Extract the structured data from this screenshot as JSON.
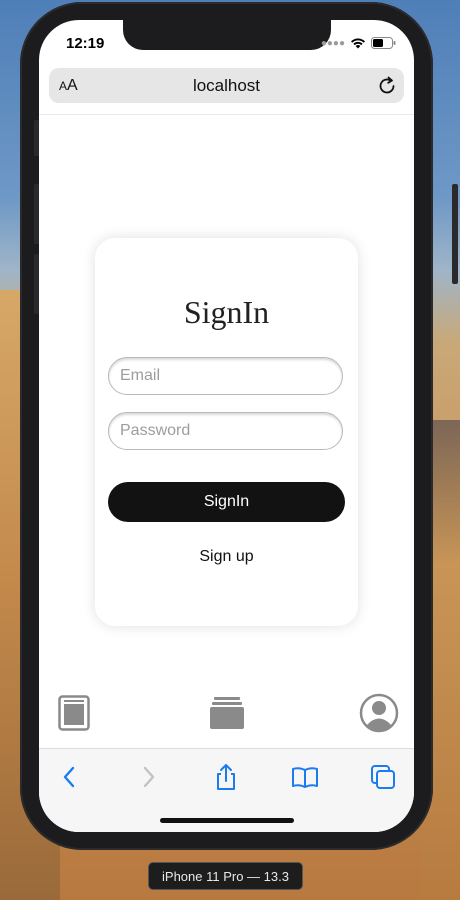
{
  "status_bar": {
    "time": "12:19"
  },
  "browser": {
    "text_size_label": "AA",
    "url": "localhost"
  },
  "signin_card": {
    "title": "SignIn",
    "email_placeholder": "Email",
    "password_placeholder": "Password",
    "submit_label": "SignIn",
    "signup_label": "Sign up"
  },
  "app_tabbar": {
    "icons": [
      "page-icon",
      "stack-icon",
      "user-icon"
    ]
  },
  "safari_toolbar": {
    "icons": [
      "back-icon",
      "forward-icon",
      "share-icon",
      "bookmarks-icon",
      "tabs-icon"
    ],
    "accent": "#1a7cf0"
  },
  "simulator": {
    "device_label": "iPhone 11 Pro — 13.3"
  }
}
